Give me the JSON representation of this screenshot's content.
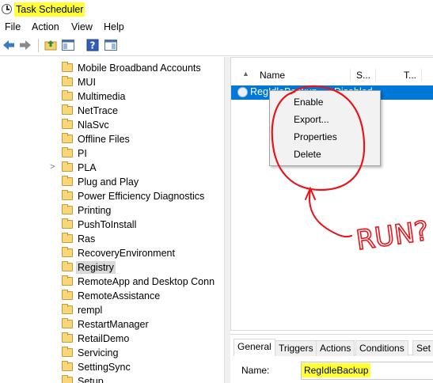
{
  "window": {
    "title": "Task Scheduler"
  },
  "menu": [
    "File",
    "Action",
    "View",
    "Help"
  ],
  "toolbar": {
    "icons": [
      "back-arrow-icon",
      "forward-arrow-icon",
      "folder-up-icon",
      "show-hide-pane-icon",
      "help-icon",
      "action-pane-icon"
    ]
  },
  "tree": {
    "items": [
      {
        "label": "Mobile Broadband Accounts"
      },
      {
        "label": "MUI"
      },
      {
        "label": "Multimedia"
      },
      {
        "label": "NetTrace"
      },
      {
        "label": "NlaSvc"
      },
      {
        "label": "Offline Files"
      },
      {
        "label": "PI"
      },
      {
        "label": "PLA",
        "expander": ">"
      },
      {
        "label": "Plug and Play"
      },
      {
        "label": "Power Efficiency Diagnostics"
      },
      {
        "label": "Printing"
      },
      {
        "label": "PushToInstall"
      },
      {
        "label": "Ras"
      },
      {
        "label": "RecoveryEnvironment"
      },
      {
        "label": "Registry",
        "selected": true
      },
      {
        "label": "RemoteApp and Desktop Conn"
      },
      {
        "label": "RemoteAssistance"
      },
      {
        "label": "rempl"
      },
      {
        "label": "RestartManager"
      },
      {
        "label": "RetailDemo"
      },
      {
        "label": "Servicing"
      },
      {
        "label": "SettingSync"
      },
      {
        "label": "Setup"
      }
    ]
  },
  "tasklist": {
    "columns": {
      "name": "Name",
      "status": "S...",
      "triggers": "T..."
    },
    "row": {
      "name": "RegIdleBackup",
      "status": "Disabled"
    }
  },
  "context_menu": {
    "items": [
      "Enable",
      "Export...",
      "Properties",
      "Delete"
    ]
  },
  "details": {
    "tabs": [
      "General",
      "Triggers",
      "Actions",
      "Conditions",
      "Set"
    ],
    "name_label": "Name:",
    "name_value": "RegIdleBackup"
  },
  "annotation": {
    "text": "RUN?",
    "color": "#e8141b"
  },
  "colors": {
    "highlight": "#ffff33",
    "selection": "#0078d7"
  }
}
